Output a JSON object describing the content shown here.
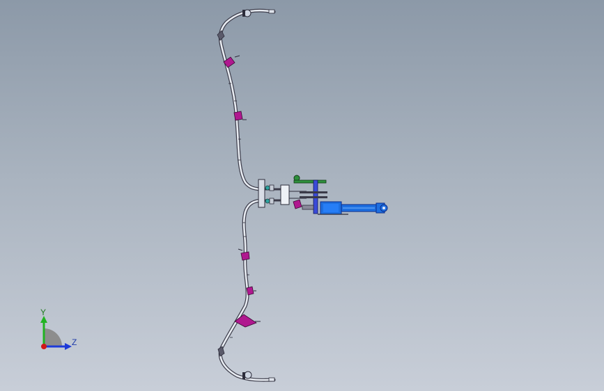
{
  "viewport": {
    "background_top": "#8c99a8",
    "background_bottom": "#c8ced8"
  },
  "model": {
    "tube_color": "#e8ecf2",
    "tube_outline": "#3c3c4a",
    "clamp_color": "#b0188f",
    "cylinder_color": "#1e6fe0",
    "cylinder_dark": "#0b2b8a",
    "valve_green": "#2e8f3c"
  },
  "triad": {
    "y_label": "Y",
    "z_label": "Z",
    "y_color": "#21b321",
    "z_color": "#1e3ad8",
    "x_color": "#d01818",
    "quadrant_color": "#8d8d8d"
  }
}
